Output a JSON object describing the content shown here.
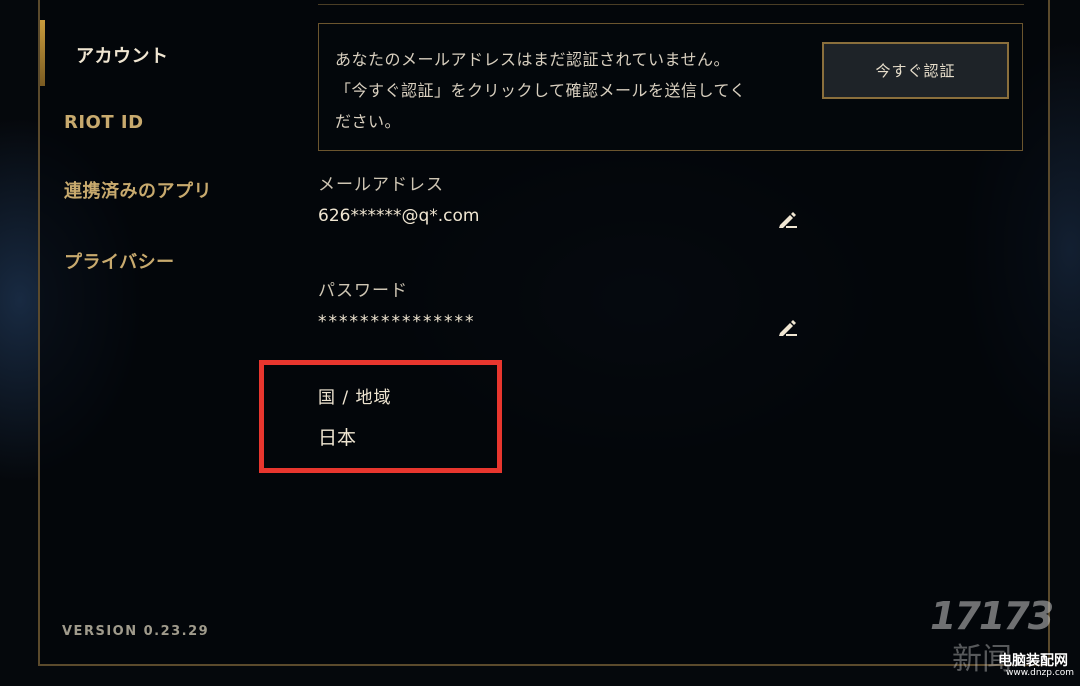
{
  "sidebar": {
    "items": [
      {
        "label": "アカウント",
        "active": true
      },
      {
        "label": "RIOT ID",
        "active": false
      },
      {
        "label": "連携済みのアプリ",
        "active": false
      },
      {
        "label": "プライバシー",
        "active": false
      }
    ],
    "version": "VERSION 0.23.29"
  },
  "notice": {
    "message": "あなたのメールアドレスはまだ認証されていません。\n「今すぐ認証」をクリックして確認メールを送信してく\nださい。",
    "verify_button": "今すぐ認証"
  },
  "fields": {
    "email": {
      "label": "メールアドレス",
      "value": "626******@q*.com"
    },
    "password": {
      "label": "パスワード",
      "value": "***************"
    },
    "region": {
      "label": "国 / 地域",
      "value": "日本"
    }
  },
  "colors": {
    "accent_gold": "#c89b3c",
    "highlight_red": "#e8362e"
  },
  "watermark": {
    "logo_text": "17173",
    "sub_text": "新闻",
    "site": "电脑装配网",
    "url": "www.dnzp.com"
  }
}
